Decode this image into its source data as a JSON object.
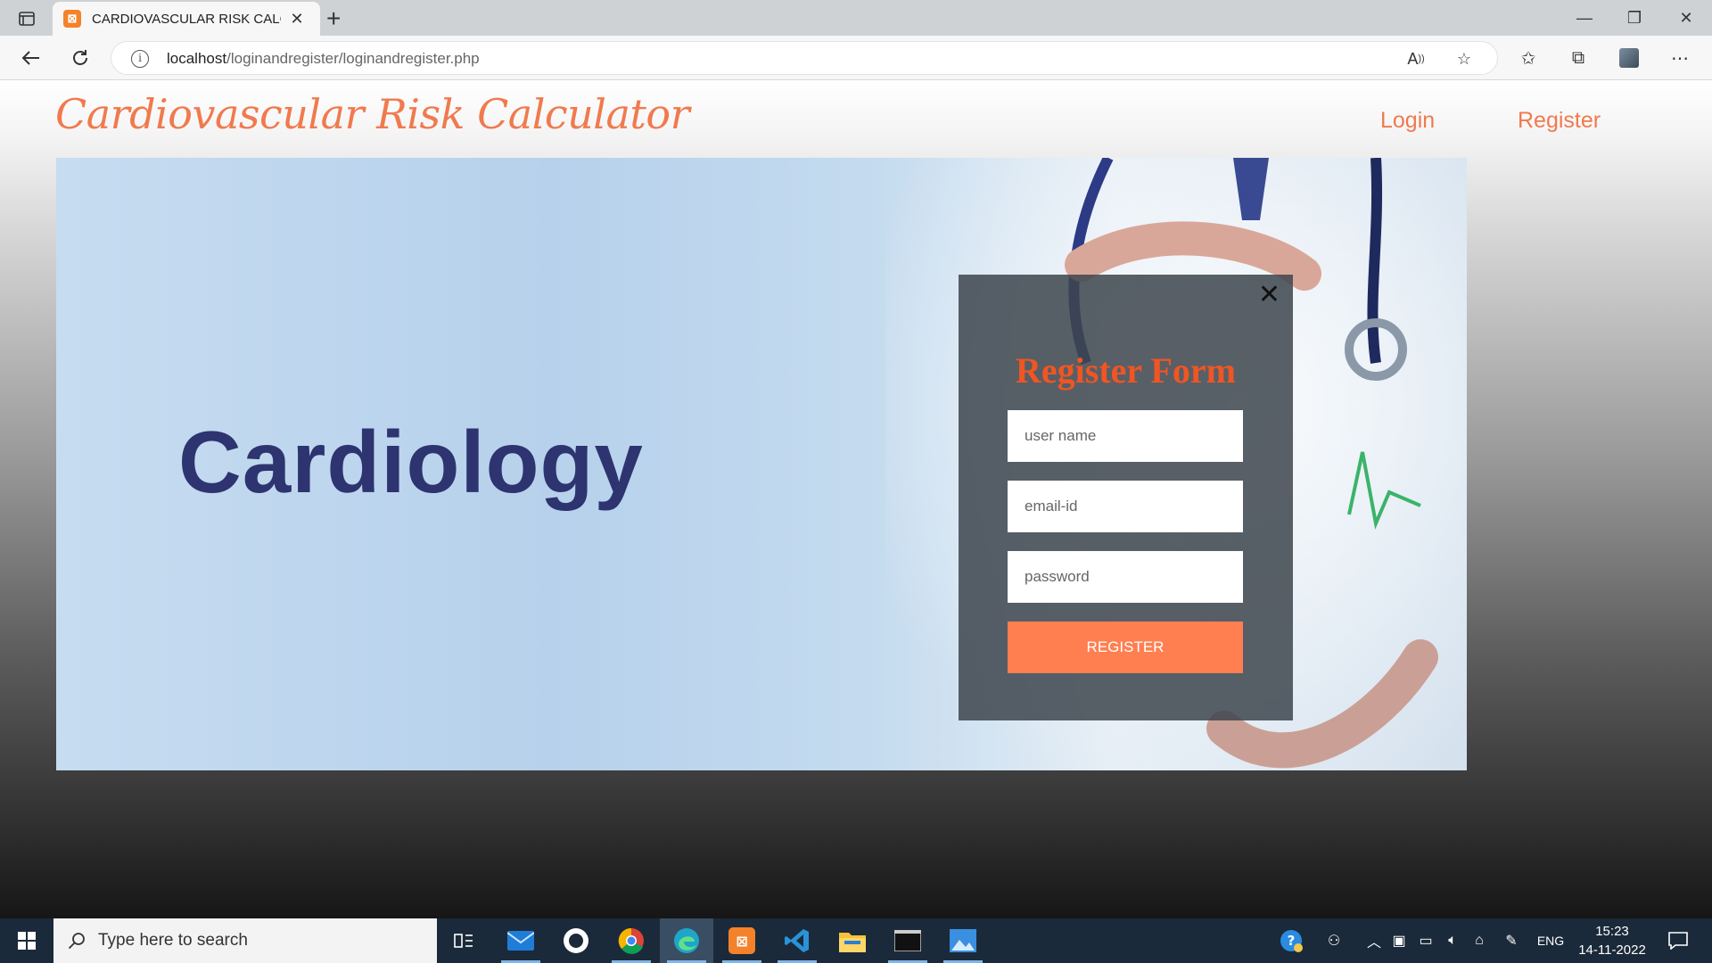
{
  "browser": {
    "tab_title": "CARDIOVASCULAR RISK CALCUL",
    "url_host": "localhost",
    "url_path": "/loginandregister/loginandregister.php"
  },
  "site": {
    "logo": "Cardiovascular Risk Calculator",
    "nav": {
      "login": "Login",
      "register": "Register"
    },
    "hero_word": "Cardiology"
  },
  "modal": {
    "title": "Register Form",
    "username_placeholder": "user name",
    "email_placeholder": "email-id",
    "password_placeholder": "password",
    "submit_label": "REGISTER"
  },
  "taskbar": {
    "search_placeholder": "Type here to search",
    "language": "ENG",
    "time": "15:23",
    "date": "14-11-2022"
  }
}
